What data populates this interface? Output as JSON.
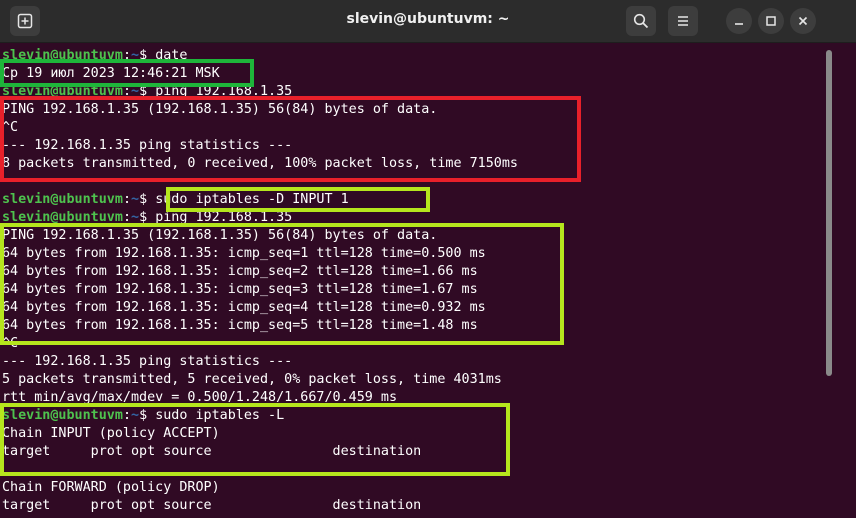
{
  "window": {
    "title": "slevin@ubuntuvm: ~"
  },
  "icons": {
    "new_tab": "new-tab-icon",
    "search": "search-icon",
    "menu": "hamburger-menu-icon",
    "minimize": "minimize-icon",
    "maximize": "maximize-icon",
    "close": "close-icon"
  },
  "colors": {
    "background": "#300a24",
    "prompt_user": "#4ec24e",
    "prompt_path": "#3465a4",
    "highlight_green": "#1eb53a",
    "highlight_red": "#e8202a",
    "highlight_lime": "#b5e61d"
  },
  "terminal": {
    "prompt_user": "slevin@ubuntuvm",
    "prompt_sep": ":",
    "prompt_path": "~",
    "prompt_end": "$ ",
    "lines": [
      {
        "type": "prompt",
        "cmd": "date"
      },
      {
        "type": "out",
        "text": "Ср 19 июл 2023 12:46:21 MSK"
      },
      {
        "type": "prompt",
        "cmd": "ping 192.168.1.35"
      },
      {
        "type": "out",
        "text": "PING 192.168.1.35 (192.168.1.35) 56(84) bytes of data."
      },
      {
        "type": "out",
        "text": "^C"
      },
      {
        "type": "out",
        "text": "--- 192.168.1.35 ping statistics ---"
      },
      {
        "type": "out",
        "text": "8 packets transmitted, 0 received, 100% packet loss, time 7150ms"
      },
      {
        "type": "out",
        "text": ""
      },
      {
        "type": "prompt",
        "cmd": "sudo iptables -D INPUT 1"
      },
      {
        "type": "prompt",
        "cmd": "ping 192.168.1.35"
      },
      {
        "type": "out",
        "text": "PING 192.168.1.35 (192.168.1.35) 56(84) bytes of data."
      },
      {
        "type": "out",
        "text": "64 bytes from 192.168.1.35: icmp_seq=1 ttl=128 time=0.500 ms"
      },
      {
        "type": "out",
        "text": "64 bytes from 192.168.1.35: icmp_seq=2 ttl=128 time=1.66 ms"
      },
      {
        "type": "out",
        "text": "64 bytes from 192.168.1.35: icmp_seq=3 ttl=128 time=1.67 ms"
      },
      {
        "type": "out",
        "text": "64 bytes from 192.168.1.35: icmp_seq=4 ttl=128 time=0.932 ms"
      },
      {
        "type": "out",
        "text": "64 bytes from 192.168.1.35: icmp_seq=5 ttl=128 time=1.48 ms"
      },
      {
        "type": "out",
        "text": "^C"
      },
      {
        "type": "out",
        "text": "--- 192.168.1.35 ping statistics ---"
      },
      {
        "type": "out",
        "text": "5 packets transmitted, 5 received, 0% packet loss, time 4031ms"
      },
      {
        "type": "out",
        "text": "rtt min/avg/max/mdev = 0.500/1.248/1.667/0.459 ms"
      },
      {
        "type": "prompt",
        "cmd": "sudo iptables -L"
      },
      {
        "type": "out",
        "text": "Chain INPUT (policy ACCEPT)"
      },
      {
        "type": "out",
        "text": "target     prot opt source               destination"
      },
      {
        "type": "out",
        "text": ""
      },
      {
        "type": "out",
        "text": "Chain FORWARD (policy DROP)"
      },
      {
        "type": "out",
        "text": "target     prot opt source               destination"
      }
    ]
  }
}
